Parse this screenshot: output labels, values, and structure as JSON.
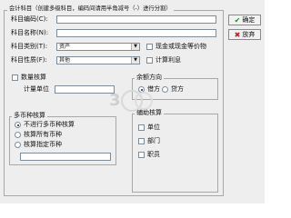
{
  "dialog": {
    "group_title": "会计科目（创建多级科目，编码间请用半角减号（-）进行分割）"
  },
  "fields": {
    "code_label": "科目编码(C):",
    "code_value": "",
    "name_label": "科目名称(N):",
    "name_value": "",
    "category_label": "科目类别(T):",
    "category_value": "资产",
    "nature_label": "科目性质(F):",
    "nature_value": "其他"
  },
  "checks": {
    "cash_label": "现金或现金等价物",
    "interest_label": "计算利息",
    "quantity_label": "数量核算",
    "unit_label": "计量单位"
  },
  "balance": {
    "title": "余额方向",
    "debit_label": "借方",
    "credit_label": "贷方",
    "selected": "借方"
  },
  "currency": {
    "title": "多币种核算",
    "options": [
      "不进行多币种核算",
      "核算所有币种",
      "核算指定币种"
    ],
    "selected": "不进行多币种核算"
  },
  "auxiliary": {
    "title": "辅助核算",
    "items": [
      "单位",
      "部门",
      "职员"
    ]
  },
  "buttons": {
    "ok_label": "确定",
    "cancel_label": "放弃"
  },
  "watermark": {
    "text": "3"
  }
}
